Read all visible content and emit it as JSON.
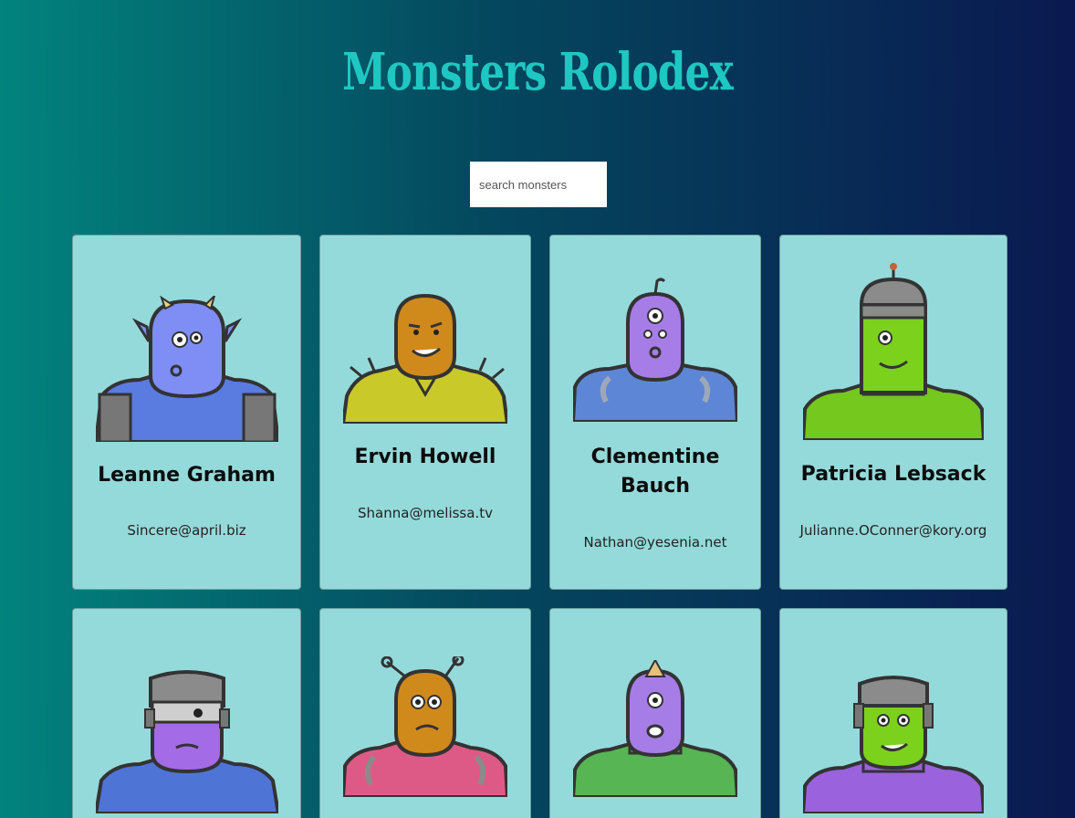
{
  "app": {
    "title": "Monsters Rolodex"
  },
  "search": {
    "placeholder": "search monsters"
  },
  "monsters": [
    {
      "name": "Leanne Graham",
      "email": "Sincere@april.biz",
      "skin": "#7f8ef5",
      "body": "#5a7be0",
      "accent": "#e8d07a"
    },
    {
      "name": "Ervin Howell",
      "email": "Shanna@melissa.tv",
      "skin": "#d08a1c",
      "body": "#c9c92a",
      "accent": "#9a9a1a"
    },
    {
      "name": "Clementine Bauch",
      "email": "Nathan@yesenia.net",
      "skin": "#a67de6",
      "body": "#5d86d6",
      "accent": "#9ca8b8"
    },
    {
      "name": "Patricia Lebsack",
      "email": "Julianne.OConner@kory.org",
      "skin": "#7bd11c",
      "body": "#75c81e",
      "accent": "#8b8b8b"
    },
    {
      "name": "",
      "email": "",
      "skin": "#a46be6",
      "body": "#4e74d6",
      "accent": "#8b8b8b"
    },
    {
      "name": "",
      "email": "",
      "skin": "#d08a1c",
      "body": "#de5a86",
      "accent": "#8b8b8b"
    },
    {
      "name": "",
      "email": "",
      "skin": "#a67de6",
      "body": "#57b553",
      "accent": "#e6c07a"
    },
    {
      "name": "",
      "email": "",
      "skin": "#7bd11c",
      "body": "#9a62dc",
      "accent": "#8b8b8b"
    }
  ]
}
